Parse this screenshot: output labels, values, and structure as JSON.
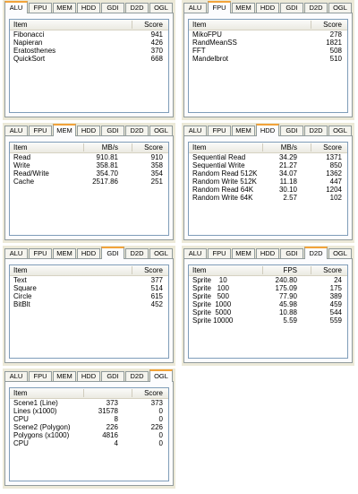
{
  "tabs": [
    "ALU",
    "FPU",
    "MEM",
    "HDD",
    "GDI",
    "D2D",
    "OGL"
  ],
  "panels": {
    "alu": {
      "active": "ALU",
      "columns": [
        "Item",
        "Score"
      ],
      "rows": [
        [
          "Fibonacci",
          "941"
        ],
        [
          "Napieran",
          "426"
        ],
        [
          "Eratosthenes",
          "370"
        ],
        [
          "QuickSort",
          "668"
        ]
      ]
    },
    "fpu": {
      "active": "FPU",
      "columns": [
        "Item",
        "Score"
      ],
      "rows": [
        [
          "MikoFPU",
          "278"
        ],
        [
          "RandMeanSS",
          "1821"
        ],
        [
          "FFT",
          "508"
        ],
        [
          "Mandelbrot",
          "510"
        ]
      ]
    },
    "mem": {
      "active": "MEM",
      "columns": [
        "Item",
        "MB/s",
        "Score"
      ],
      "rows": [
        [
          "Read",
          "910.81",
          "910"
        ],
        [
          "Write",
          "358.81",
          "358"
        ],
        [
          "Read/Write",
          "354.70",
          "354"
        ],
        [
          "Cache",
          "2517.86",
          "251"
        ]
      ]
    },
    "hdd": {
      "active": "HDD",
      "columns": [
        "Item",
        "MB/s",
        "Score"
      ],
      "rows": [
        [
          "Sequential Read",
          "34.29",
          "1371"
        ],
        [
          "Sequential Write",
          "21.27",
          "850"
        ],
        [
          "Random Read 512K",
          "34.07",
          "1362"
        ],
        [
          "Random Write 512K",
          "11.18",
          "447"
        ],
        [
          "Random Read 64K",
          "30.10",
          "1204"
        ],
        [
          "Random Write 64K",
          "2.57",
          "102"
        ]
      ]
    },
    "gdi": {
      "active": "GDI",
      "columns": [
        "Item",
        "Score"
      ],
      "rows": [
        [
          "Text",
          "377"
        ],
        [
          "Square",
          "514"
        ],
        [
          "Circle",
          "615"
        ],
        [
          "BitBlt",
          "452"
        ]
      ]
    },
    "d2d": {
      "active": "D2D",
      "columns": [
        "Item",
        "FPS",
        "Score"
      ],
      "rows": [
        [
          "Sprite    10",
          "240.80",
          "24"
        ],
        [
          "Sprite   100",
          "175.09",
          "175"
        ],
        [
          "Sprite   500",
          "77.90",
          "389"
        ],
        [
          "Sprite  1000",
          "45.98",
          "459"
        ],
        [
          "Sprite  5000",
          "10.88",
          "544"
        ],
        [
          "Sprite 10000",
          "5.59",
          "559"
        ]
      ]
    },
    "ogl": {
      "active": "OGL",
      "columns": [
        "Item",
        "",
        "Score"
      ],
      "rows": [
        [
          "Scene1 (Line)",
          "373",
          "373"
        ],
        [
          "Lines (x1000)",
          "31578",
          "0"
        ],
        [
          "CPU",
          "8",
          "0"
        ],
        [
          "Scene2 (Polygon)",
          "226",
          "226"
        ],
        [
          "Polygons (x1000)",
          "4816",
          "0"
        ],
        [
          "CPU",
          "4",
          "0"
        ]
      ]
    }
  }
}
